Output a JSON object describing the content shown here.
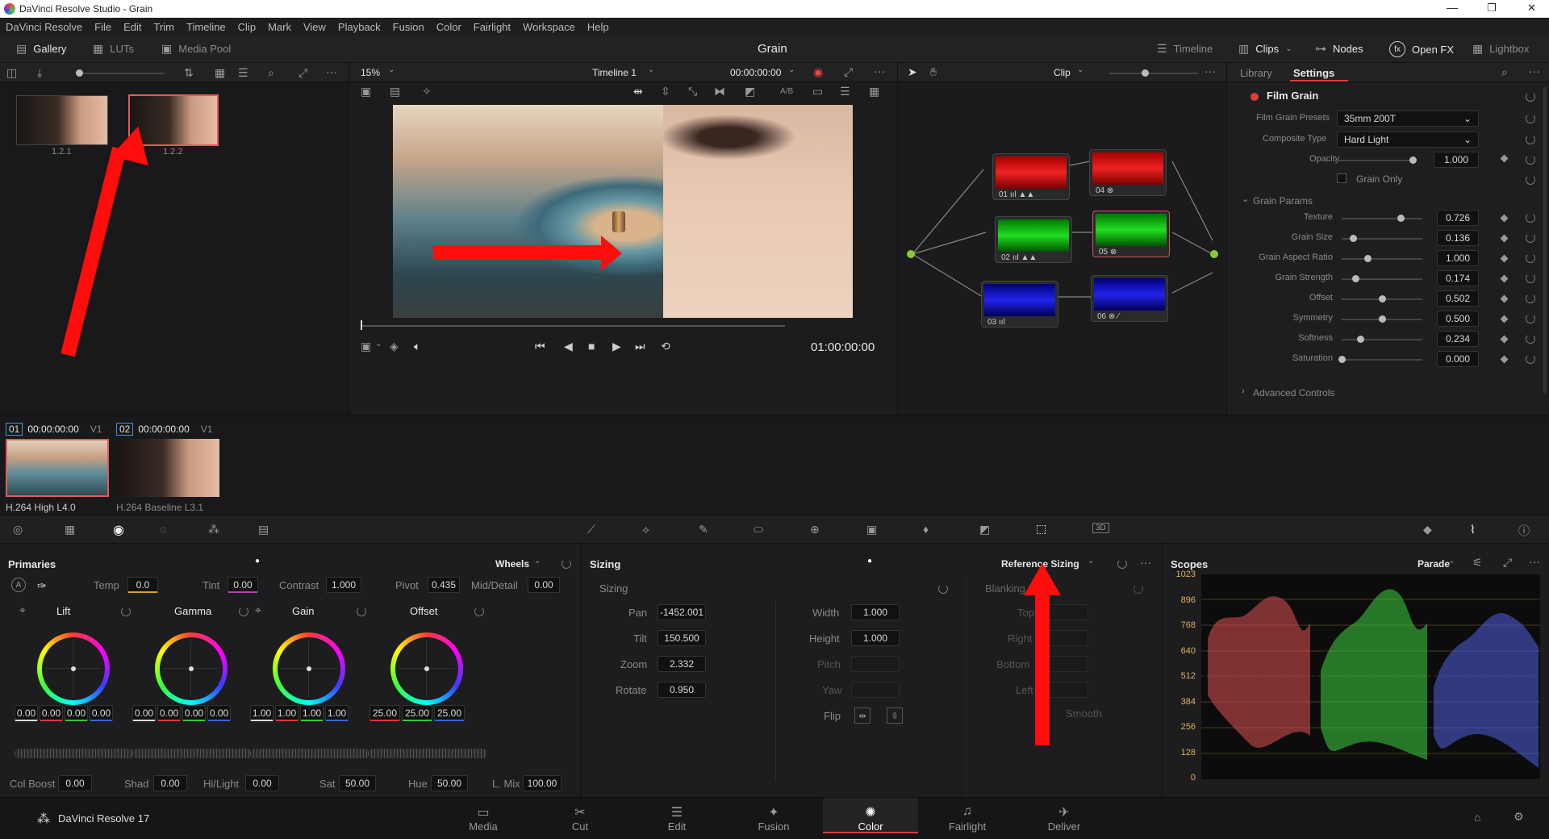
{
  "window": {
    "title": "DaVinci Resolve Studio - Grain",
    "controls": [
      "—",
      "❐",
      "✕"
    ]
  },
  "menu": [
    "DaVinci Resolve",
    "File",
    "Edit",
    "Trim",
    "Timeline",
    "Clip",
    "Mark",
    "View",
    "Playback",
    "Fusion",
    "Color",
    "Fairlight",
    "Workspace",
    "Help"
  ],
  "toolbar": {
    "gallery": "Gallery",
    "luts": "LUTs",
    "media_pool": "Media Pool",
    "project_title": "Grain",
    "timeline": "Timeline",
    "clips": "Clips",
    "nodes": "Nodes",
    "open_fx": "Open FX",
    "lightbox": "Lightbox"
  },
  "viewer": {
    "zoom": "15%",
    "timeline_name": "Timeline 1",
    "timecode": "00:00:00:00",
    "clip_mode": "Clip",
    "playhead_tc": "01:00:00:00",
    "ab_label": "A/B"
  },
  "gallery_stills": [
    {
      "label": "1.2.1"
    },
    {
      "label": "1.2.2"
    }
  ],
  "nodes": [
    {
      "label": "01",
      "icons": "ııl ▲▲"
    },
    {
      "label": "02",
      "icons": "ııl ▲▲"
    },
    {
      "label": "03",
      "icons": "ııl"
    },
    {
      "label": "04",
      "icons": "⊗"
    },
    {
      "label": "05",
      "icons": "⊗"
    },
    {
      "label": "06",
      "icons": "⊗ ∕"
    }
  ],
  "right_panel": {
    "tab_library": "Library",
    "tab_settings": "Settings",
    "effect_name": "Film Grain",
    "film_grain_presets_label": "Film Grain Presets",
    "film_grain_presets_value": "35mm 200T",
    "composite_type_label": "Composite Type",
    "composite_type_value": "Hard Light",
    "opacity_label": "Opacity",
    "opacity_value": "1.000",
    "grain_only_label": "Grain Only",
    "grain_params_header": "Grain Params",
    "params": [
      {
        "label": "Texture",
        "value": "0.726",
        "pos": 0.726
      },
      {
        "label": "Grain Size",
        "value": "0.136",
        "pos": 0.136
      },
      {
        "label": "Grain Aspect Ratio",
        "value": "1.000",
        "pos": 0.32
      },
      {
        "label": "Grain Strength",
        "value": "0.174",
        "pos": 0.174
      },
      {
        "label": "Offset",
        "value": "0.502",
        "pos": 0.502
      },
      {
        "label": "Symmetry",
        "value": "0.500",
        "pos": 0.5
      },
      {
        "label": "Softness",
        "value": "0.234",
        "pos": 0.234
      },
      {
        "label": "Saturation",
        "value": "0.000",
        "pos": 0.0
      }
    ],
    "advanced_controls": "Advanced Controls"
  },
  "clips": [
    {
      "num": "01",
      "tc": "00:00:00:00",
      "track": "V1",
      "codec": "H.264 High L4.0"
    },
    {
      "num": "02",
      "tc": "00:00:00:00",
      "track": "V1",
      "codec": "H.264 Baseline L3.1"
    }
  ],
  "primaries": {
    "title": "Primaries",
    "mode": "Wheels",
    "temp_label": "Temp",
    "temp": "0.0",
    "tint_label": "Tint",
    "tint": "0.00",
    "contrast_label": "Contrast",
    "contrast": "1.000",
    "pivot_label": "Pivot",
    "pivot": "0.435",
    "middetail_label": "Mid/Detail",
    "middetail": "0.00",
    "wheels": [
      {
        "name": "Lift",
        "values": [
          "0.00",
          "0.00",
          "0.00",
          "0.00"
        ]
      },
      {
        "name": "Gamma",
        "values": [
          "0.00",
          "0.00",
          "0.00",
          "0.00"
        ]
      },
      {
        "name": "Gain",
        "values": [
          "1.00",
          "1.00",
          "1.00",
          "1.00"
        ]
      },
      {
        "name": "Offset",
        "values": [
          "25.00",
          "25.00",
          "25.00"
        ]
      }
    ],
    "colboost_label": "Col Boost",
    "colboost": "0.00",
    "shad_label": "Shad",
    "shad": "0.00",
    "hilight_label": "Hi/Light",
    "hilight": "0.00",
    "sat_label": "Sat",
    "sat": "50.00",
    "hue_label": "Hue",
    "hue": "50.00",
    "lmix_label": "L. Mix",
    "lmix": "100.00"
  },
  "sizing": {
    "title": "Sizing",
    "section": "Sizing",
    "mode": "Reference Sizing",
    "pan_label": "Pan",
    "pan": "-1452.001",
    "tilt_label": "Tilt",
    "tilt": "150.500",
    "zoom_label": "Zoom",
    "zoom": "2.332",
    "rotate_label": "Rotate",
    "rotate": "0.950",
    "width_label": "Width",
    "width": "1.000",
    "height_label": "Height",
    "height": "1.000",
    "pitch_label": "Pitch",
    "yaw_label": "Yaw",
    "flip_label": "Flip",
    "blanking_label": "Blanking",
    "top_label": "Top",
    "right_label": "Right",
    "bottom_label": "Bottom",
    "left_label": "Left",
    "smooth_label": "Smooth"
  },
  "scopes": {
    "title": "Scopes",
    "mode": "Parade",
    "axis": [
      "1023",
      "896",
      "768",
      "640",
      "512",
      "384",
      "256",
      "128",
      "0"
    ]
  },
  "bottom_nav": {
    "app_name": "DaVinci Resolve 17",
    "pages": [
      "Media",
      "Cut",
      "Edit",
      "Fusion",
      "Color",
      "Fairlight",
      "Deliver"
    ],
    "active": "Color"
  },
  "colors": {
    "accent": "#e23a3a",
    "annotation_red": "#ff0d0d",
    "active_tab": "#e0e0e0"
  }
}
